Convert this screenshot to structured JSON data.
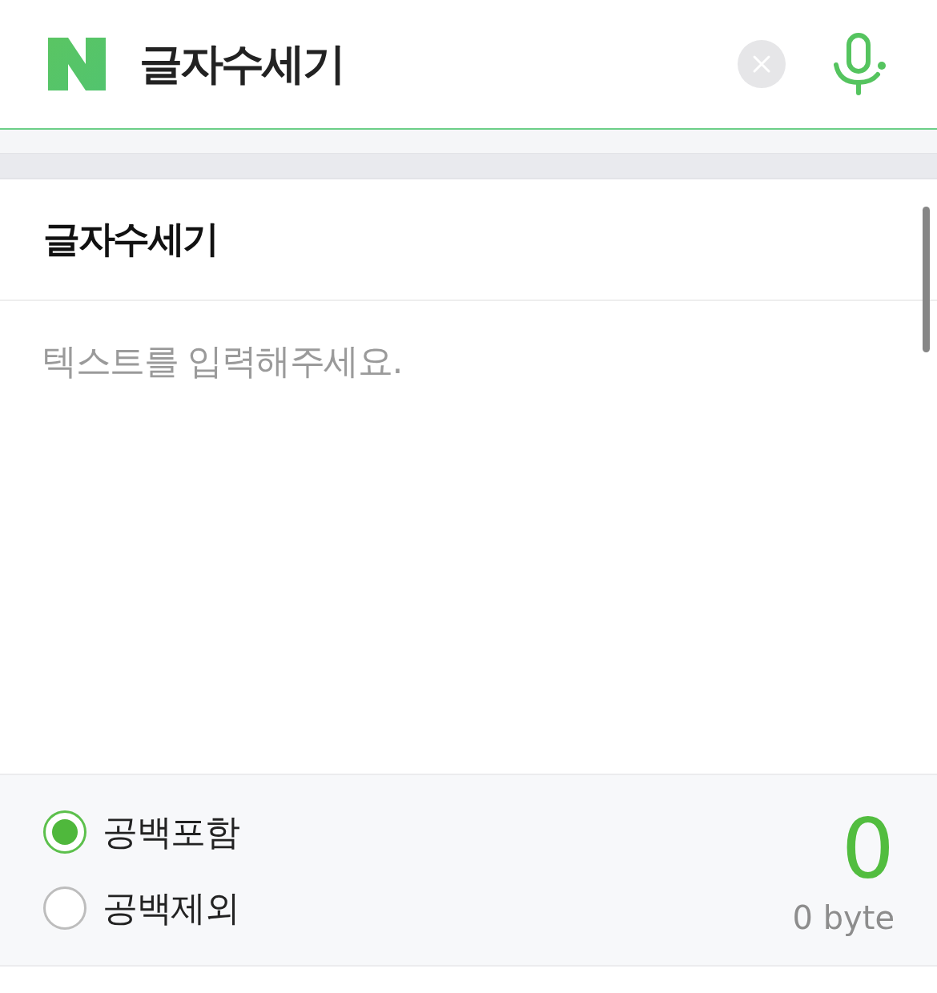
{
  "search": {
    "value": "글자수세기"
  },
  "counter": {
    "title": "글자수세기",
    "input": {
      "placeholder": "텍스트를 입력해주세요."
    },
    "options": [
      {
        "label": "공백포함",
        "selected": true
      },
      {
        "label": "공백제외",
        "selected": false
      }
    ],
    "count": "0",
    "bytes": "0 byte"
  }
}
